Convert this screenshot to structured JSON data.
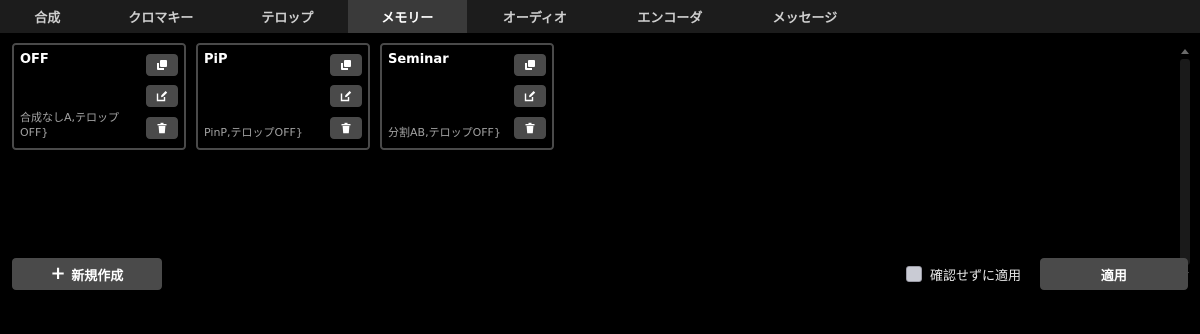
{
  "tabs": [
    {
      "label": "合成",
      "active": false
    },
    {
      "label": "クロマキー",
      "active": false
    },
    {
      "label": "テロップ",
      "active": false
    },
    {
      "label": "メモリー",
      "active": true
    },
    {
      "label": "オーディオ",
      "active": false
    },
    {
      "label": "エンコーダ",
      "active": false
    },
    {
      "label": "メッセージ",
      "active": false
    }
  ],
  "memories": [
    {
      "title": "OFF",
      "description": "合成なしA,テロップOFF}"
    },
    {
      "title": "PiP",
      "description": "PinP,テロップOFF}"
    },
    {
      "title": "Seminar",
      "description": "分割AB,テロップOFF}"
    }
  ],
  "card_actions": {
    "copy_icon": "copy-icon",
    "edit_icon": "edit-icon",
    "delete_icon": "trash-icon"
  },
  "footer": {
    "new_button_icon": "+",
    "new_button_label": "新規作成",
    "confirm_label": "確認せずに適用",
    "confirm_checked": false,
    "apply_button_label": "適用"
  },
  "colors": {
    "background": "#000000",
    "tabbar": "#1c1c1c",
    "active_tab": "#3a3a3a",
    "button": "#4a4a4a",
    "card_border": "#4a4a4a",
    "muted_text": "#a0a0a0"
  }
}
